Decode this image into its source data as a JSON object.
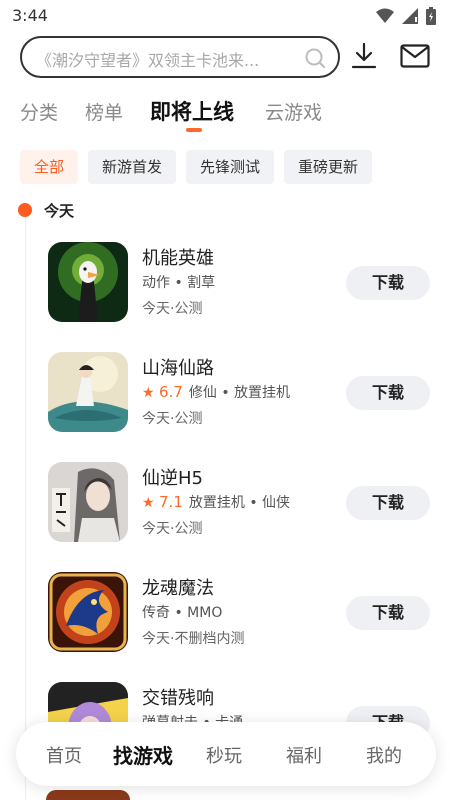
{
  "status": {
    "time": "3:44"
  },
  "search": {
    "placeholder": "《潮汐守望者》双领主卡池来..."
  },
  "tabs": [
    {
      "label": "分类"
    },
    {
      "label": "榜单"
    },
    {
      "label": "即将上线"
    },
    {
      "label": "云游戏"
    }
  ],
  "filters": [
    {
      "label": "全部"
    },
    {
      "label": "新游首发"
    },
    {
      "label": "先锋测试"
    },
    {
      "label": "重磅更新"
    }
  ],
  "day_label": "今天",
  "games": [
    {
      "name": "机能英雄",
      "score": "",
      "tags": "动作 • 割草",
      "when": "今天·公测",
      "button": "下载"
    },
    {
      "name": "山海仙路",
      "score": "6.7",
      "tags": "修仙 • 放置挂机",
      "when": "今天·公测",
      "button": "下载"
    },
    {
      "name": "仙逆H5",
      "score": "7.1",
      "tags": "放置挂机 • 仙侠",
      "when": "今天·公测",
      "button": "下载"
    },
    {
      "name": "龙魂魔法",
      "score": "",
      "tags": "传奇 • MMO",
      "when": "今天·不删档内测",
      "button": "下载"
    },
    {
      "name": "交错残响",
      "score": "",
      "tags": "弹幕射击 • 卡通",
      "when": "",
      "button": "下载"
    }
  ],
  "bottom_nav": [
    {
      "label": "首页"
    },
    {
      "label": "找游戏"
    },
    {
      "label": "秒玩"
    },
    {
      "label": "福利"
    },
    {
      "label": "我的"
    }
  ],
  "colors": {
    "accent": "#ff5a1f",
    "chip_bg": "#f1f2f5",
    "button_bg": "#eef0f4"
  }
}
